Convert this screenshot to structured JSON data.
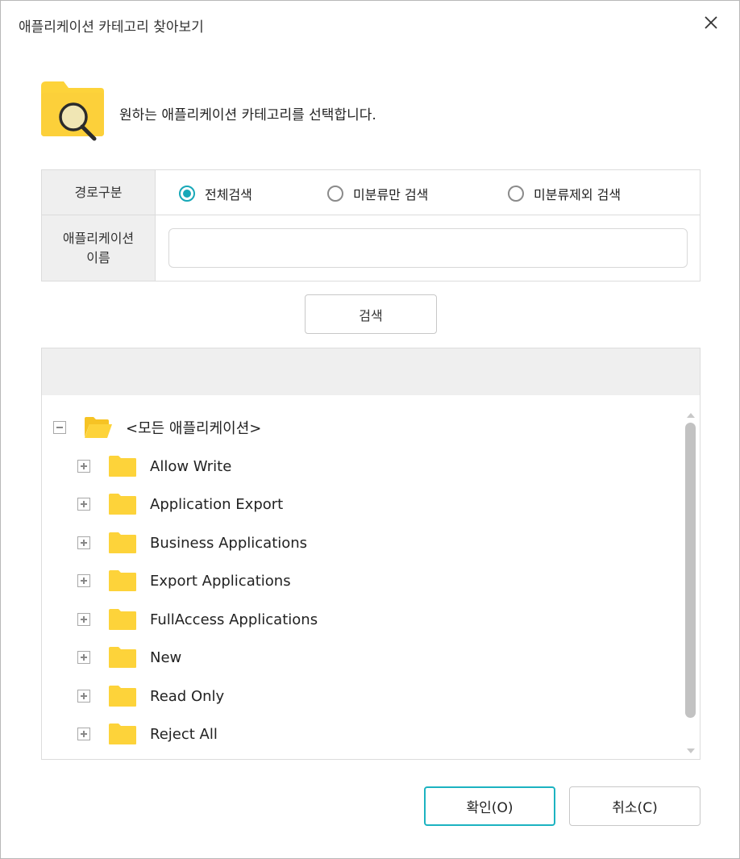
{
  "window": {
    "title": "애플리케이션 카테고리 찾아보기"
  },
  "intro": {
    "text": "원하는 애플리케이션 카테고리를 선택합니다."
  },
  "form": {
    "path_label": "경로구분",
    "radio_options": [
      {
        "label": "전체검색",
        "checked": true
      },
      {
        "label": "미분류만 검색",
        "checked": false
      },
      {
        "label": "미분류제외 검색",
        "checked": false
      }
    ],
    "name_label_line1": "애플리케이션",
    "name_label_line2": "이름",
    "name_value": "",
    "name_placeholder": ""
  },
  "search_button": "검색",
  "tree": {
    "root": {
      "label": "<모든 애플리케이션>",
      "expanded": true
    },
    "items": [
      {
        "label": "Allow Write"
      },
      {
        "label": "Application Export"
      },
      {
        "label": "Business Applications"
      },
      {
        "label": "Export Applications"
      },
      {
        "label": "FullAccess Applications"
      },
      {
        "label": "New"
      },
      {
        "label": "Read Only"
      },
      {
        "label": "Reject All"
      }
    ]
  },
  "buttons": {
    "ok": "확인(O)",
    "cancel": "취소(C)"
  },
  "colors": {
    "accent": "#17a8b8",
    "folder": "#fdd33a",
    "header_bg": "#efefef"
  }
}
